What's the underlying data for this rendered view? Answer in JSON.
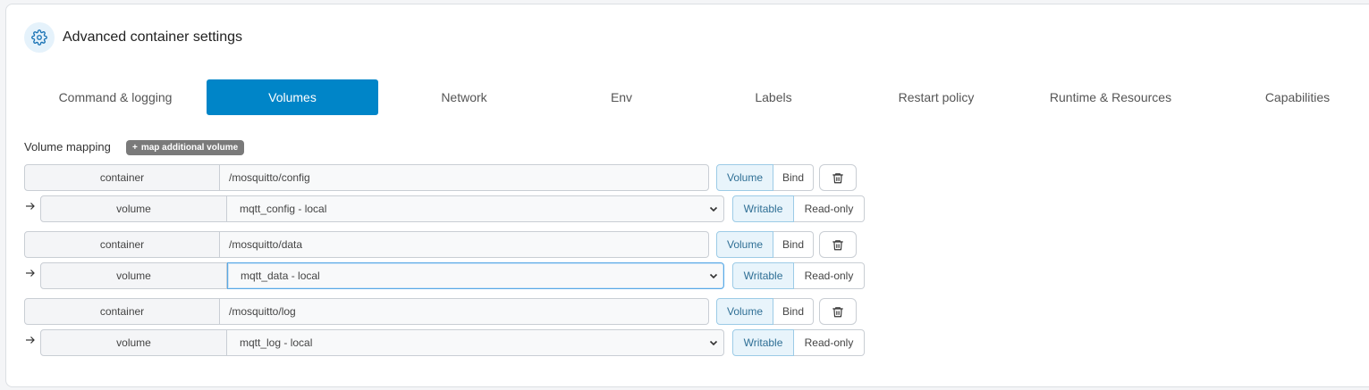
{
  "panel": {
    "title": "Advanced container settings",
    "title_icon": "gear-icon"
  },
  "tabs": [
    {
      "label": "Command & logging",
      "active": false
    },
    {
      "label": "Volumes",
      "active": true
    },
    {
      "label": "Network",
      "active": false
    },
    {
      "label": "Env",
      "active": false
    },
    {
      "label": "Labels",
      "active": false
    },
    {
      "label": "Restart policy",
      "active": false
    },
    {
      "label": "Runtime & Resources",
      "active": false
    },
    {
      "label": "Capabilities",
      "active": false
    }
  ],
  "volumes": {
    "label": "Volume mapping",
    "add_button": "map additional volume",
    "add_icon": "+",
    "mappings": [
      {
        "container_label": "container",
        "container_path": "/mosquitto/config",
        "type_options": [
          "Volume",
          "Bind"
        ],
        "type_selected": "Volume",
        "volume_label": "volume",
        "volume_value": "mqtt_config - local",
        "mode_options": [
          "Writable",
          "Read-only"
        ],
        "mode_selected": "Writable"
      },
      {
        "container_label": "container",
        "container_path": "/mosquitto/data",
        "type_options": [
          "Volume",
          "Bind"
        ],
        "type_selected": "Volume",
        "volume_label": "volume",
        "volume_value": "mqtt_data - local",
        "mode_options": [
          "Writable",
          "Read-only"
        ],
        "mode_selected": "Writable"
      },
      {
        "container_label": "container",
        "container_path": "/mosquitto/log",
        "type_options": [
          "Volume",
          "Bind"
        ],
        "type_selected": "Volume",
        "volume_label": "volume",
        "volume_value": "mqtt_log - local",
        "mode_options": [
          "Writable",
          "Read-only"
        ],
        "mode_selected": "Writable"
      }
    ]
  },
  "colors": {
    "accent": "#0085c8",
    "selected_bg": "#e8f4fb"
  }
}
